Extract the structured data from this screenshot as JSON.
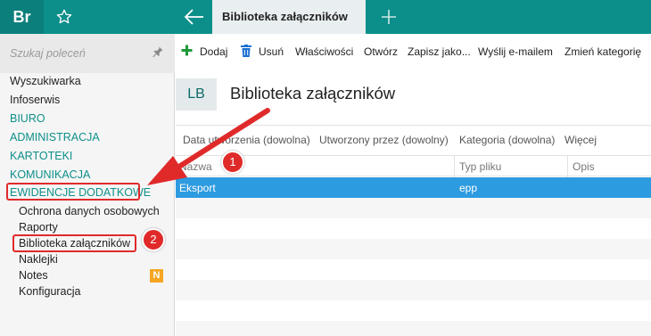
{
  "app": {
    "brand": "Br",
    "active_tab": "Biblioteka załączników"
  },
  "sidebar": {
    "search_placeholder": "Szukaj poleceń",
    "items": [
      {
        "label": "Wyszukiwarka",
        "type": "item"
      },
      {
        "label": "Infoserwis",
        "type": "item"
      },
      {
        "label": "BIURO",
        "type": "category"
      },
      {
        "label": "ADMINISTRACJA",
        "type": "category"
      },
      {
        "label": "KARTOTEKI",
        "type": "category"
      },
      {
        "label": "KOMUNIKACJA",
        "type": "category"
      },
      {
        "label": "EWIDENCJE DODATKOWE",
        "type": "category"
      },
      {
        "label": "Ochrona danych osobowych",
        "type": "sub"
      },
      {
        "label": "Raporty",
        "type": "sub"
      },
      {
        "label": "Biblioteka załączników",
        "type": "sub"
      },
      {
        "label": "Naklejki",
        "type": "sub"
      },
      {
        "label": "Notes",
        "type": "sub"
      },
      {
        "label": "Konfiguracja",
        "type": "sub"
      }
    ],
    "notes_badge": "N"
  },
  "toolbar": {
    "add": "Dodaj",
    "delete": "Usuń",
    "properties": "Właściwości",
    "open": "Otwórz",
    "save_as": "Zapisz jako...",
    "email": "Wyślij e-mailem",
    "change_category": "Zmień kategorię"
  },
  "header": {
    "badge": "LB",
    "title": "Biblioteka załączników"
  },
  "filters": {
    "created_date": "Data utworzenia (dowolna)",
    "created_by": "Utworzony przez (dowolny)",
    "category": "Kategoria (dowolna)",
    "more": "Więcej"
  },
  "grid": {
    "columns": [
      "Nazwa",
      "Typ pliku",
      "Opis"
    ],
    "rows": [
      {
        "name": "Eksport",
        "type": "epp",
        "desc": ""
      }
    ]
  },
  "annotations": {
    "step1": "1",
    "step2": "2"
  },
  "colors": {
    "topbar": "#0c8f8a",
    "category_text": "#0e8f8a",
    "selection": "#2d9be0",
    "annotation_red": "#e02a2a",
    "badge_orange": "#f5a623"
  }
}
